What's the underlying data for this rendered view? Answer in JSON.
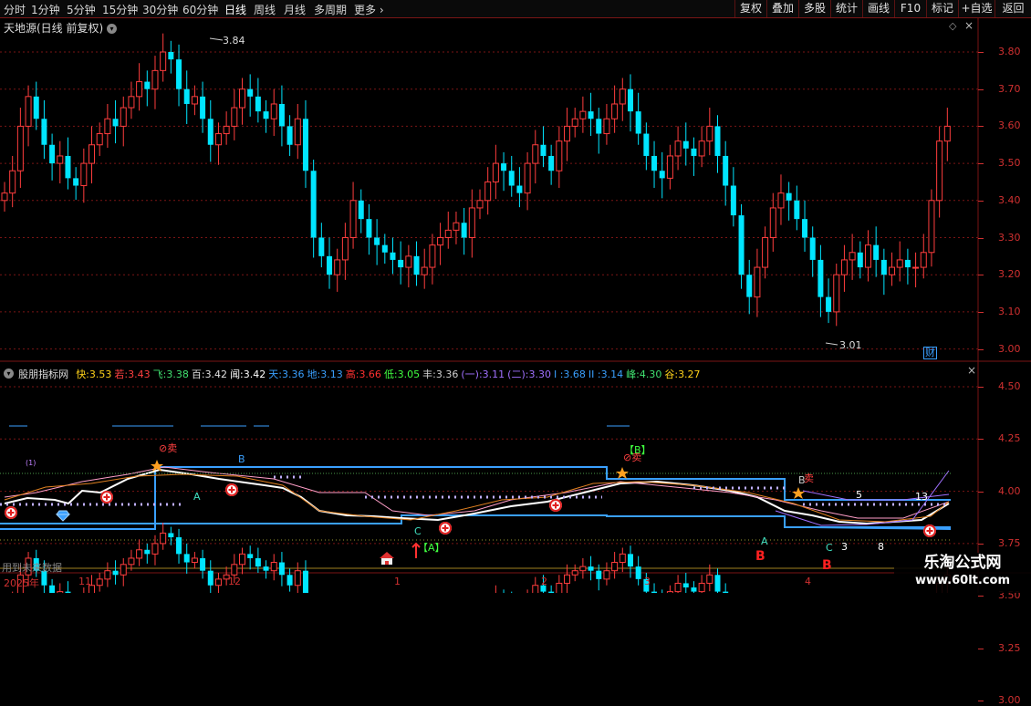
{
  "toolbar": {
    "periods": [
      "分时",
      "1分钟",
      "5分钟",
      "15分钟",
      "30分钟",
      "60分钟",
      "日线",
      "周线",
      "月线",
      "多周期",
      "更多"
    ],
    "active_period": "日线",
    "right_buttons": [
      "复权",
      "叠加",
      "多股",
      "统计",
      "画线",
      "F10",
      "标记",
      "+自选",
      "返回"
    ]
  },
  "main_chart": {
    "title": "天地源(日线 前复权)",
    "high_label": "3.84",
    "low_label": "3.01",
    "badge": "财",
    "y_ticks": [
      "3.80",
      "3.70",
      "3.60",
      "3.50",
      "3.40",
      "3.30",
      "3.20",
      "3.10",
      "3.00"
    ]
  },
  "indicator": {
    "name": "股朋指标网",
    "values": [
      {
        "label": "快:",
        "value": "3.53",
        "color": "#ffd21a"
      },
      {
        "label": "若:",
        "value": "3.43",
        "color": "#ff4040"
      },
      {
        "label": "飞:",
        "value": "3.38",
        "color": "#40e070"
      },
      {
        "label": "百:",
        "value": "3.42",
        "color": "#e0e0e0"
      },
      {
        "label": "闻:",
        "value": "3.42",
        "color": "#ffffff"
      },
      {
        "label": "天:",
        "value": "3.36",
        "color": "#3aa0ff"
      },
      {
        "label": "地:",
        "value": "3.13",
        "color": "#3aa0ff"
      },
      {
        "label": "高:",
        "value": "3.66",
        "color": "#ff3030"
      },
      {
        "label": "低:",
        "value": "3.05",
        "color": "#40ff40"
      },
      {
        "label": "丰:",
        "value": "3.36",
        "color": "#d0d0d0"
      },
      {
        "label": "(一):",
        "value": "3.11",
        "color": "#a070ff"
      },
      {
        "label": "(二):",
        "value": "3.30",
        "color": "#a070ff"
      },
      {
        "label": "I :",
        "value": "3.68",
        "color": "#3aa0ff"
      },
      {
        "label": "II :",
        "value": "3.14",
        "color": "#3aa0ff"
      },
      {
        "label": "峰:",
        "value": "4.30",
        "color": "#40e070"
      },
      {
        "label": "谷:",
        "value": "3.27",
        "color": "#ffd21a"
      }
    ],
    "y_ticks": [
      "4.50",
      "4.25",
      "4.00",
      "3.75",
      "3.50",
      "3.25",
      "3.00"
    ],
    "annotations": {
      "sell": "卖",
      "b_bracket": "【B】",
      "a_bracket": "【A】",
      "letter_a": "A",
      "letter_b": "B",
      "letter_c": "C",
      "num_1": "(1)",
      "num_5": "5",
      "num_3": "3",
      "num_8": "8",
      "num_13": "13",
      "future_data": "用到未来数据"
    }
  },
  "date_axis": [
    "2025年",
    "11",
    "12",
    "1",
    "2",
    "3",
    "4"
  ],
  "watermark": {
    "line1": "乐淘公式网",
    "line2": "www.60lt.com"
  },
  "colors": {
    "up": "#ff3d3d",
    "down": "#00e5ff",
    "grid": "#7a1515",
    "accent_blue": "#3aa0ff"
  }
}
